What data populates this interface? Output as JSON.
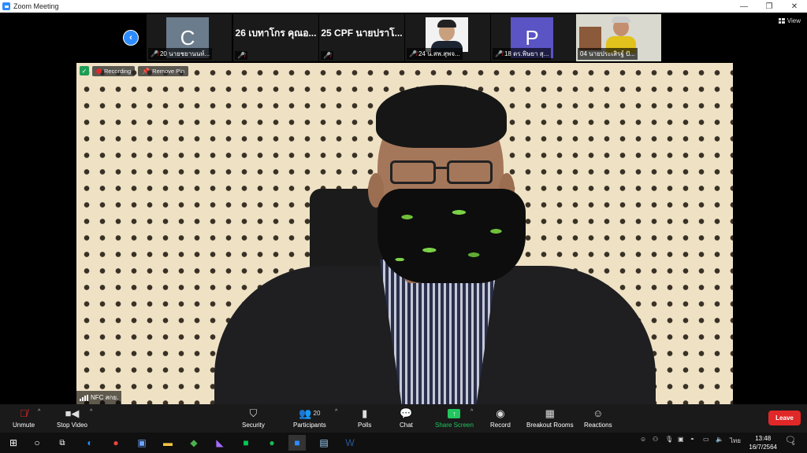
{
  "window": {
    "title": "Zoom Meeting",
    "controls": {
      "minimize": "—",
      "restore": "❐",
      "close": "✕"
    }
  },
  "view_button": {
    "label": "View"
  },
  "gallery": {
    "prev_arrow": "‹",
    "tiles": [
      {
        "type": "avatar",
        "letter": "C",
        "avatar_color": "#6b7c8c",
        "caption": "20 นายชยานนท์..."
      },
      {
        "type": "name",
        "big_name": "26 เบทาโกร คุณอ...",
        "caption": ""
      },
      {
        "type": "name",
        "big_name": "25 CPF นายปราโ...",
        "caption": ""
      },
      {
        "type": "video",
        "caption": "24 น.สพ.สุพจ..."
      },
      {
        "type": "avatar",
        "letter": "P",
        "avatar_color": "#5a54c4",
        "caption": "18 ดร.พิษยา สุ..."
      },
      {
        "type": "video2",
        "caption": "04 นายประเสิรฐ์ ปั..."
      }
    ]
  },
  "main_video": {
    "recording_label": "Recording",
    "remove_pin_label": "Remove Pin",
    "speaker_name": "NFC สกย."
  },
  "toolbar": {
    "unmute": "Unmute",
    "stop_video": "Stop Video",
    "security": "Security",
    "participants": "Participants",
    "participants_count": "20",
    "polls": "Polls",
    "chat": "Chat",
    "share_screen": "Share Screen",
    "record": "Record",
    "breakout_rooms": "Breakout Rooms",
    "reactions": "Reactions",
    "leave": "Leave",
    "accent_green": "#22c55e",
    "leave_color": "#e02828"
  },
  "taskbar": {
    "language": "ไทย",
    "time": "13:48",
    "date": "16/7/2564",
    "notification_count": "5"
  }
}
